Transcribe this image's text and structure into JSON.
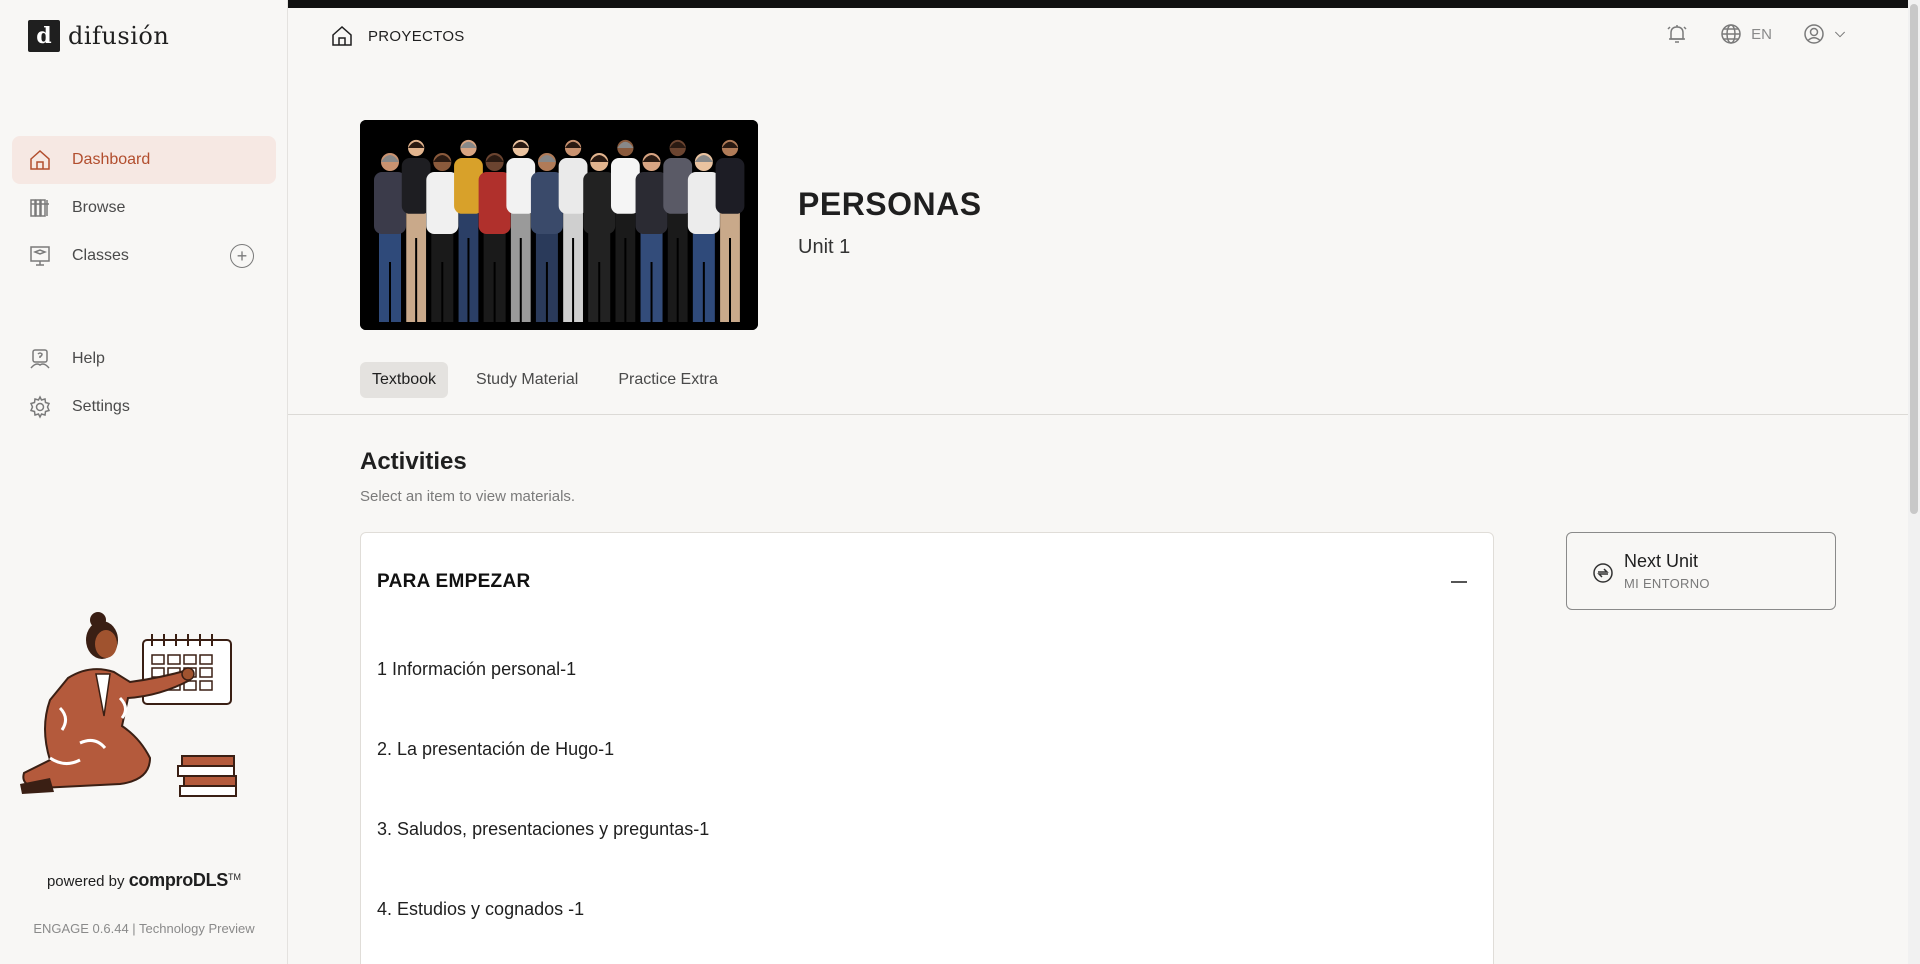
{
  "app": {
    "logo_mark": "d",
    "logo_text": "difusión"
  },
  "sidebar": {
    "items": [
      {
        "label": "Dashboard",
        "icon": "home-icon",
        "active": true
      },
      {
        "label": "Browse",
        "icon": "books-icon",
        "active": false
      },
      {
        "label": "Classes",
        "icon": "classroom-icon",
        "active": false
      }
    ],
    "add_symbol": "+",
    "bottom_items": [
      {
        "label": "Help",
        "icon": "help-icon"
      },
      {
        "label": "Settings",
        "icon": "gear-icon"
      }
    ],
    "powered_prefix": "powered by",
    "powered_brand": "comproDLS",
    "powered_tm": "TM",
    "version": "ENGAGE 0.6.44 | Technology Preview"
  },
  "header": {
    "breadcrumb": "PROYECTOS",
    "language": "EN",
    "icons": [
      "bell-icon",
      "globe-icon",
      "user-icon",
      "chevron-down-icon"
    ]
  },
  "unit": {
    "title": "PERSONAS",
    "subtitle": "Unit 1"
  },
  "tabs": [
    {
      "label": "Textbook",
      "active": true
    },
    {
      "label": "Study Material",
      "active": false
    },
    {
      "label": "Practice Extra",
      "active": false
    }
  ],
  "activities": {
    "title": "Activities",
    "subtitle": "Select an item to view materials.",
    "section": "PARA EMPEZAR",
    "items": [
      "1 Información personal-1",
      "2. La presentación de Hugo-1",
      "3. Saludos, presentaciones y preguntas-1",
      "4. Estudios y cognados -1"
    ]
  },
  "next_unit": {
    "label": "Next Unit",
    "sub": "MI ENTORNO"
  },
  "colors": {
    "accent": "#b24e2e",
    "active_bg": "#f6e8e3",
    "page_bg": "#f8f7f5"
  }
}
